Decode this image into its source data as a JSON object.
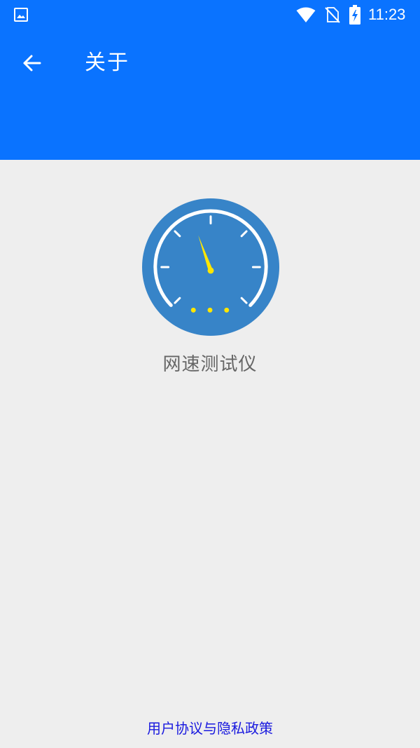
{
  "status_bar": {
    "time": "11:23",
    "icons": [
      "gallery-icon",
      "wifi-icon",
      "no-sim-icon",
      "battery-charging-icon"
    ]
  },
  "toolbar": {
    "back_icon": "arrow-left-icon",
    "title": "关于"
  },
  "about": {
    "logo_icon": "speedometer-icon",
    "app_name": "网速测试仪",
    "policy_link": "用户协议与隐私政策"
  },
  "colors": {
    "primary": "#0a73ff",
    "background": "#eeeeee",
    "logo_circle": "#3784c8",
    "needle": "#ffe600",
    "app_name_text": "#666666",
    "link_text": "#1a1adf"
  }
}
